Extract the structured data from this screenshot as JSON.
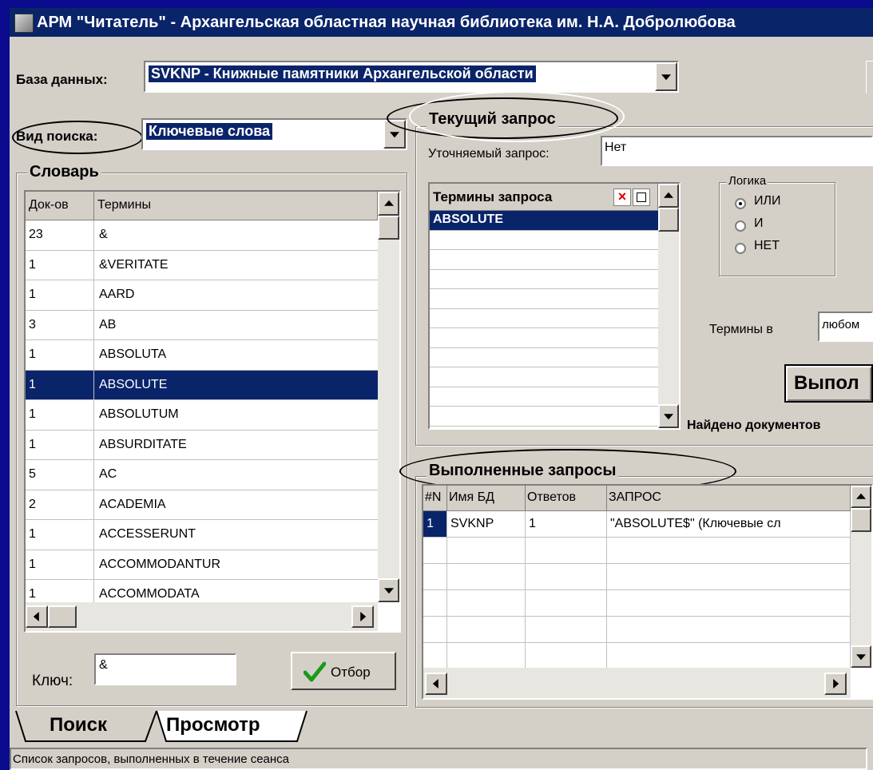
{
  "window": {
    "title": "АРМ \"Читатель\" - Архангельская областная научная библиотека им. Н.А. Добролюбова"
  },
  "database": {
    "label": "База данных:",
    "value": "SVKNP - Книжные памятники Архангельской области"
  },
  "search_type": {
    "label": "Вид поиска:",
    "value": "Ключевые слова"
  },
  "dictionary": {
    "title": "Словарь",
    "columns": [
      "Док-ов",
      "Термины"
    ],
    "rows": [
      [
        "23",
        "&"
      ],
      [
        "1",
        "&VERITATE"
      ],
      [
        "1",
        "AARD"
      ],
      [
        "3",
        "AB"
      ],
      [
        "1",
        "ABSOLUTA"
      ],
      [
        "1",
        "ABSOLUTE"
      ],
      [
        "1",
        "ABSOLUTUM"
      ],
      [
        "1",
        "ABSURDITATE"
      ],
      [
        "5",
        "AC"
      ],
      [
        "2",
        "ACADEMIA"
      ],
      [
        "1",
        "ACCESSERUNT"
      ],
      [
        "1",
        "ACCOMMODANTUR"
      ],
      [
        "1",
        "ACCOMMODATA"
      ]
    ],
    "selected_row": 5
  },
  "key": {
    "label": "Ключ:",
    "value": "&"
  },
  "select_button": {
    "label": "Отбор"
  },
  "current_query": {
    "title": "Текущий запрос",
    "refine_label": "Уточняемый запрос:",
    "refine_value": "Нет",
    "terms_header": "Термины запроса",
    "terms": [
      "ABSOLUTE"
    ]
  },
  "logic": {
    "title": "Логика",
    "options": [
      "ИЛИ",
      "И",
      "НЕТ"
    ],
    "selected": 0
  },
  "terms_in": {
    "label": "Термины в",
    "value": "любом"
  },
  "execute_button": {
    "label": "Выпол"
  },
  "found": {
    "label": "Найдено документов"
  },
  "executed": {
    "title": "Выполненные запросы",
    "columns": [
      "#N",
      "Имя БД",
      "Ответов",
      "ЗАПРОС"
    ],
    "rows": [
      [
        "1",
        "SVKNP",
        "1",
        "\"ABSOLUTE$\" (Ключевые сл"
      ]
    ]
  },
  "tabs": [
    "Поиск",
    "Просмотр"
  ],
  "status": "Список запросов, выполненных в течение сеанса",
  "colors": {
    "selection": "#0a246a",
    "face": "#d4d0c8",
    "desktop": "#0a0a8c"
  }
}
